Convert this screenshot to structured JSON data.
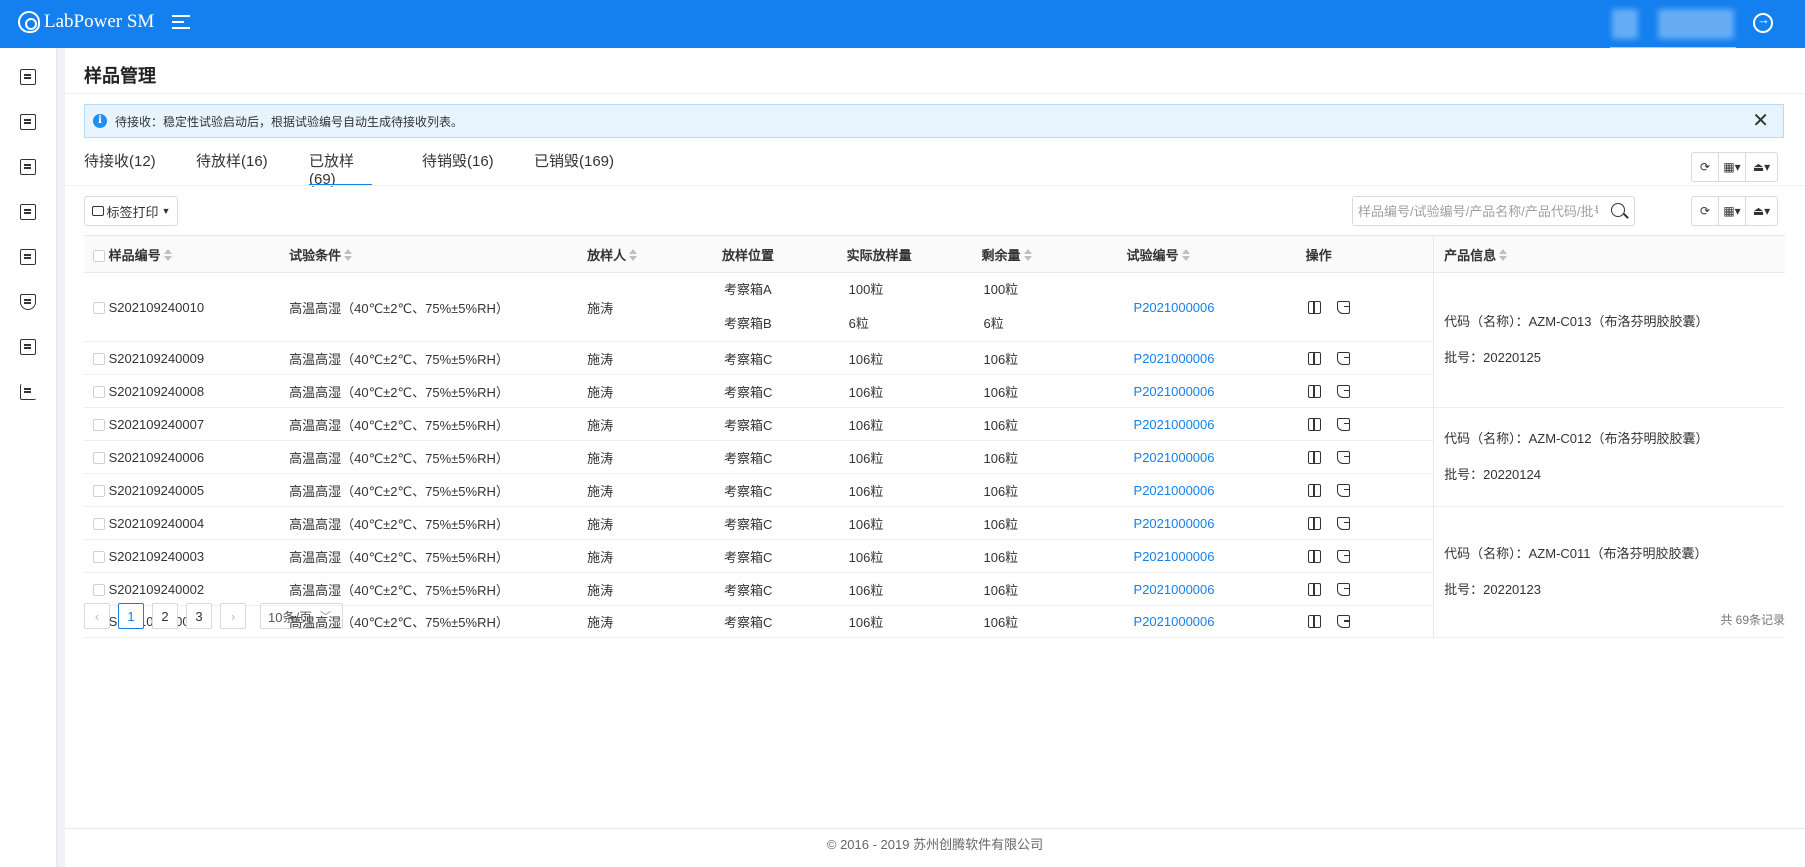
{
  "app": {
    "title": "LabPower SM"
  },
  "page": {
    "title": "样品管理"
  },
  "alert": {
    "text": "待接收：稳定性试验启动后，根据试验编号自动生成待接收列表。"
  },
  "tabs": [
    {
      "label": "待接收(12)"
    },
    {
      "label": "待放样(16)"
    },
    {
      "label": "已放样(69)",
      "active": true
    },
    {
      "label": "待销毁(16)"
    },
    {
      "label": "已销毁(169)"
    }
  ],
  "toolbar": {
    "print_label": "标签打印",
    "search_placeholder": "样品编号/试验编号/产品名称/产品代码/批号"
  },
  "table": {
    "headers": {
      "sample_no": "样品编号",
      "condition": "试验条件",
      "person": "放样人",
      "location": "放样位置",
      "actual_qty": "实际放样量",
      "remaining": "剩余量",
      "test_no": "试验编号",
      "ops": "操作",
      "product_info": "产品信息"
    },
    "rows": [
      {
        "sample_no": "S202109240010",
        "condition": "高温高湿（40℃±2℃、75%±5%RH）",
        "person": "施涛",
        "location": [
          "考察箱A",
          "考察箱B"
        ],
        "actual_qty": [
          "100粒",
          "6粒"
        ],
        "remaining": [
          "100粒",
          "6粒"
        ],
        "test_no": "P2021000006"
      },
      {
        "sample_no": "S202109240009",
        "condition": "高温高湿（40℃±2℃、75%±5%RH）",
        "person": "施涛",
        "location": "考察箱C",
        "actual_qty": "106粒",
        "remaining": "106粒",
        "test_no": "P2021000006"
      },
      {
        "sample_no": "S202109240008",
        "condition": "高温高湿（40℃±2℃、75%±5%RH）",
        "person": "施涛",
        "location": "考察箱C",
        "actual_qty": "106粒",
        "remaining": "106粒",
        "test_no": "P2021000006"
      },
      {
        "sample_no": "S202109240007",
        "condition": "高温高湿（40℃±2℃、75%±5%RH）",
        "person": "施涛",
        "location": "考察箱C",
        "actual_qty": "106粒",
        "remaining": "106粒",
        "test_no": "P2021000006"
      },
      {
        "sample_no": "S202109240006",
        "condition": "高温高湿（40℃±2℃、75%±5%RH）",
        "person": "施涛",
        "location": "考察箱C",
        "actual_qty": "106粒",
        "remaining": "106粒",
        "test_no": "P2021000006"
      },
      {
        "sample_no": "S202109240005",
        "condition": "高温高湿（40℃±2℃、75%±5%RH）",
        "person": "施涛",
        "location": "考察箱C",
        "actual_qty": "106粒",
        "remaining": "106粒",
        "test_no": "P2021000006"
      },
      {
        "sample_no": "S202109240004",
        "condition": "高温高湿（40℃±2℃、75%±5%RH）",
        "person": "施涛",
        "location": "考察箱C",
        "actual_qty": "106粒",
        "remaining": "106粒",
        "test_no": "P2021000006"
      },
      {
        "sample_no": "S202109240003",
        "condition": "高温高湿（40℃±2℃、75%±5%RH）",
        "person": "施涛",
        "location": "考察箱C",
        "actual_qty": "106粒",
        "remaining": "106粒",
        "test_no": "P2021000006"
      },
      {
        "sample_no": "S202109240002",
        "condition": "高温高湿（40℃±2℃、75%±5%RH）",
        "person": "施涛",
        "location": "考察箱C",
        "actual_qty": "106粒",
        "remaining": "106粒",
        "test_no": "P2021000006"
      },
      {
        "sample_no": "S202109240001",
        "condition": "高温高湿（40℃±2℃、75%±5%RH）",
        "person": "施涛",
        "location": "考察箱C",
        "actual_qty": "106粒",
        "remaining": "106粒",
        "test_no": "P2021000006"
      }
    ],
    "product_groups": [
      {
        "code": "代码（名称）：AZM-C013（布洛芬明胶胶囊）",
        "batch": "批号：20220125",
        "rows": 3
      },
      {
        "code": "代码（名称）：AZM-C012（布洛芬明胶胶囊）",
        "batch": "批号：20220124",
        "rows": 3
      },
      {
        "code": "代码（名称）：AZM-C011（布洛芬明胶胶囊）",
        "batch": "批号：20220123",
        "rows": 4
      }
    ]
  },
  "pagination": {
    "pages": [
      "1",
      "2",
      "3"
    ],
    "current": "1",
    "page_size": "10条/页",
    "total": "共 69条记录"
  },
  "footer": {
    "copyright": "© 2016 - 2019 苏州创腾软件有限公司"
  },
  "icons": {
    "sidebar": [
      "sample-icon",
      "document-icon",
      "checklist-icon",
      "code-icon",
      "report-user-icon",
      "flask-icon",
      "structure-icon",
      "analytics-icon"
    ],
    "row_ops": [
      "package-icon",
      "move-out-icon"
    ]
  }
}
